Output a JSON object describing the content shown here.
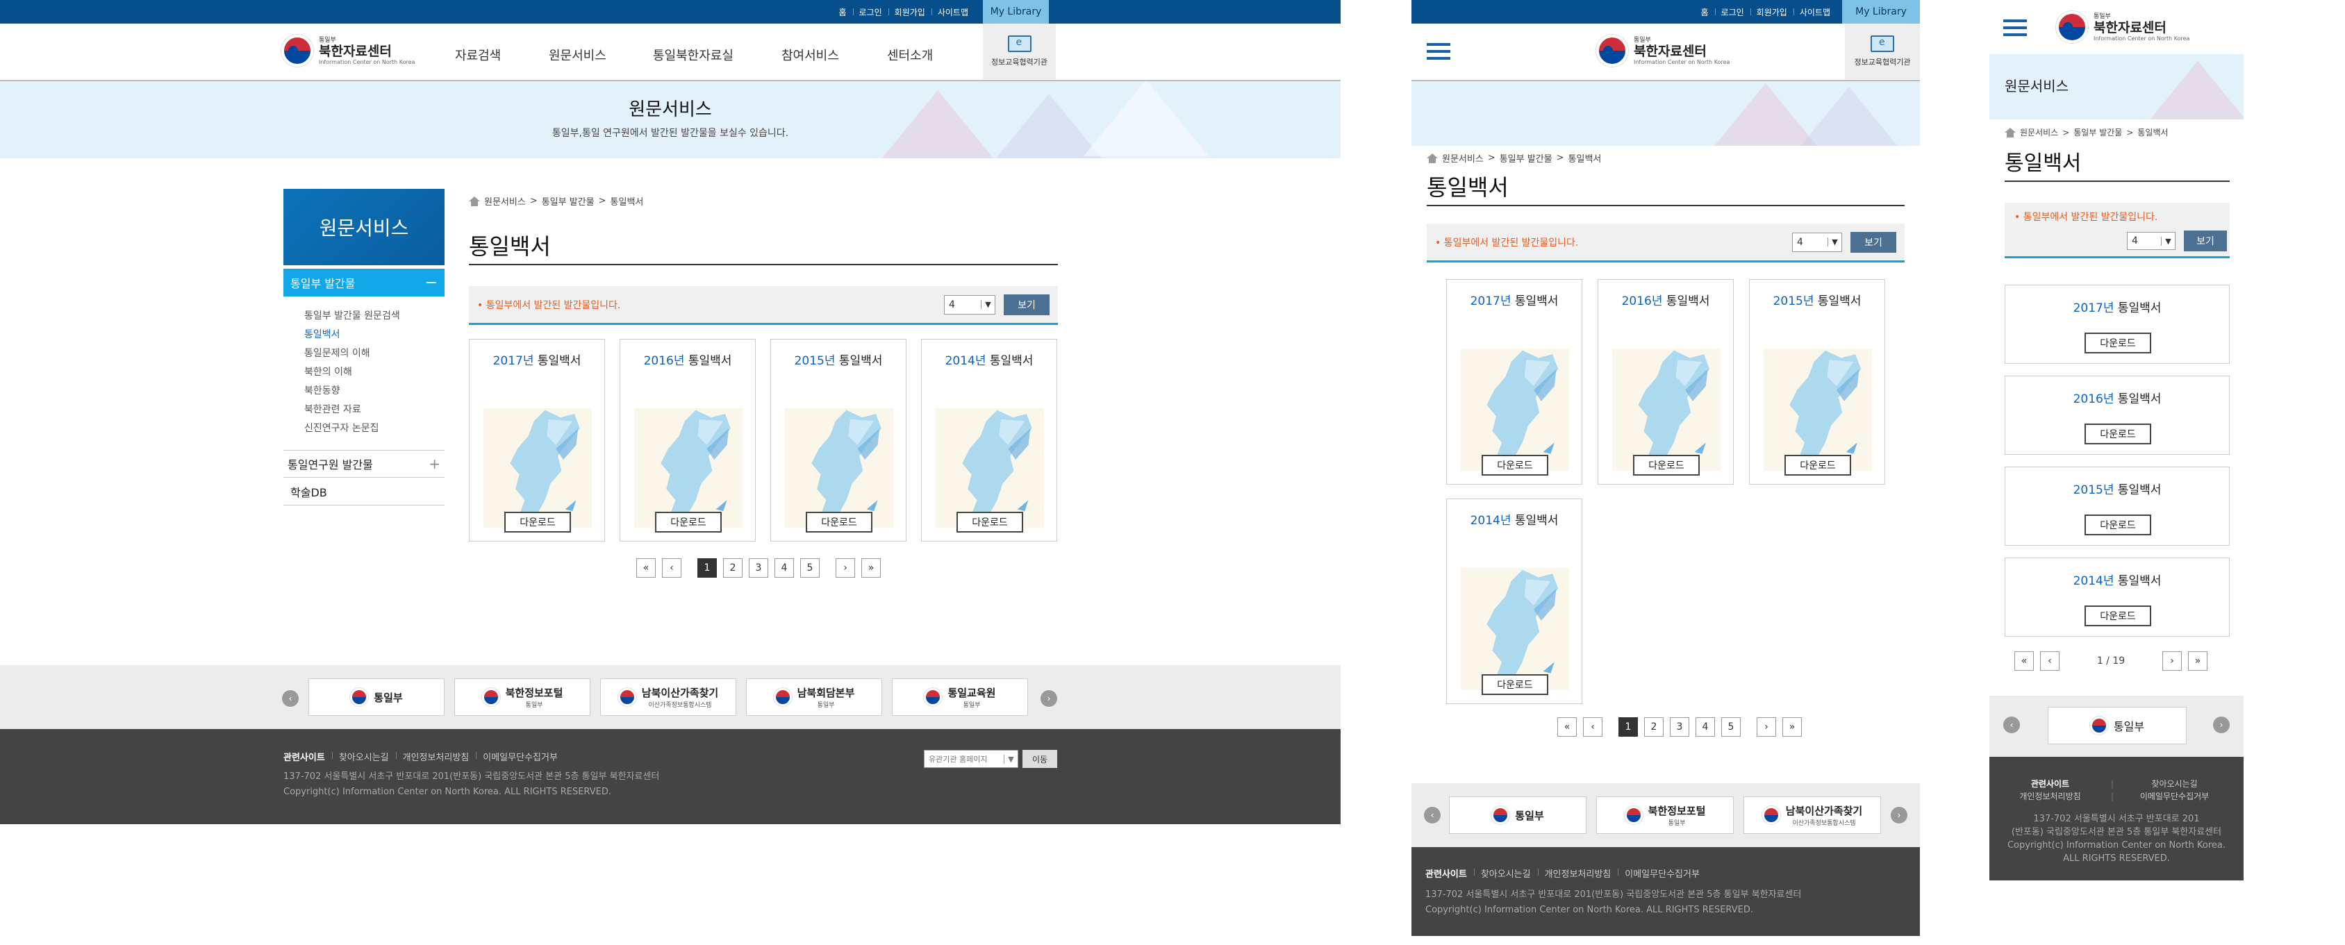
{
  "util": {
    "links": [
      "홈",
      "로그인",
      "회원가입",
      "사이트맵"
    ],
    "mylib": "My Library"
  },
  "logo": {
    "ministry": "통일부",
    "name": "북한자료센터",
    "eng": "Information Center on North Korea"
  },
  "gnb": [
    "자료검색",
    "원문서비스",
    "통일북한자료실",
    "참여서비스",
    "센터소개"
  ],
  "edu": "정보교육협력기관",
  "banner": {
    "title": "원문서비스",
    "sub": "통일부,통일 연구원에서 발간된 발간물을 보실수 있습니다."
  },
  "lnb": {
    "title": "원문서비스",
    "active": "통일부 발간물",
    "active_icon": "−",
    "sub": [
      "통일부 발간물 원문검색",
      "통일백서",
      "통일문제의 이해",
      "북한의 이해",
      "북한동향",
      "북한관련 자료",
      "신진연구자 논문집"
    ],
    "items": [
      {
        "label": "통일연구원 발간물",
        "icon": "+"
      },
      {
        "label": "학술DB",
        "icon": ""
      }
    ]
  },
  "breadcrumb": [
    "원문서비스",
    ">",
    "통일부 발간물",
    ">",
    "통일백서"
  ],
  "page_title": "통일백서",
  "filter": {
    "msg": "• 통일부에서 발간된 발간물입니다.",
    "value": "4",
    "button": "보기"
  },
  "cards": [
    {
      "year": "2017년",
      "title": "통일백서",
      "button": "다운로드"
    },
    {
      "year": "2016년",
      "title": "통일백서",
      "button": "다운로드"
    },
    {
      "year": "2015년",
      "title": "통일백서",
      "button": "다운로드"
    },
    {
      "year": "2014년",
      "title": "통일백서",
      "button": "다운로드"
    }
  ],
  "pagination": {
    "first": "«",
    "prev": "‹",
    "pages": [
      "1",
      "2",
      "3",
      "4",
      "5"
    ],
    "current": "1",
    "next": "›",
    "last": "»",
    "mobile": "1 / 19"
  },
  "footer_logos": [
    {
      "label": "통일부"
    },
    {
      "label": "북한정보포털",
      "sub": "통일부"
    },
    {
      "label": "남북이산가족찾기",
      "sub": "이산가족정보통합시스템"
    },
    {
      "label": "남북회담본부",
      "sub": "통일부"
    },
    {
      "label": "통일교육원",
      "sub": "통일부"
    }
  ],
  "footer": {
    "links": [
      "관련사이트",
      "찾아오시는길",
      "개인정보처리방침",
      "이메일무단수집거부"
    ],
    "select": "유관기관 홈페이지",
    "go": "이동",
    "address": "137-702 서울특별시 서초구 반포대로 201(반포동) 국립중앙도서관 본관 5층 통일부 북한자료센터",
    "copyright": "Copyright(c) Information Center on North Korea. ALL RIGHTS RESERVED.",
    "addr_m1": "137-702 서울특별시 서초구 반포대로 201",
    "addr_m2": "(반포동) 국립중앙도서관 본관 5층 통일부 북한자료센터",
    "copy_m1": "Copyright(c) Information Center on North Korea.",
    "copy_m2": "ALL RIGHTS RESERVED."
  },
  "colors": {
    "navy": "#064e8c",
    "sky": "#7fc2e8",
    "accent": "#10a6e8",
    "orange": "#e35c20"
  }
}
